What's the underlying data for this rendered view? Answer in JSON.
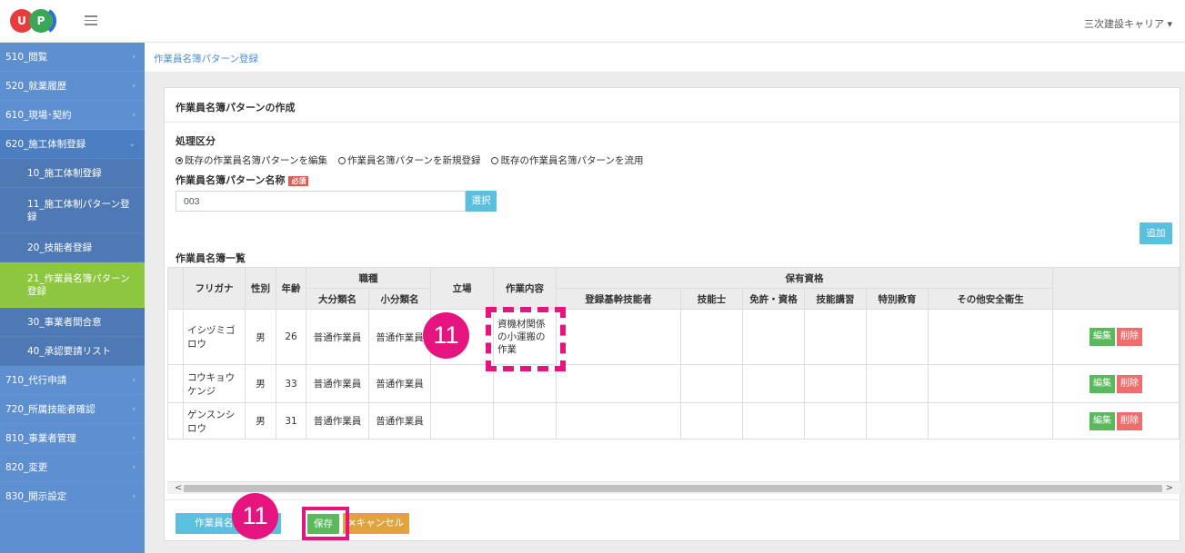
{
  "header": {
    "logo_text": "UP",
    "user_menu": "三次建設キャリア ▾"
  },
  "sidebar": {
    "items": [
      {
        "label": "510_閲覧"
      },
      {
        "label": "520_就業履歴"
      },
      {
        "label": "610_現場･契約"
      },
      {
        "label": "620_施工体制登録"
      },
      {
        "label": "710_代行申請"
      },
      {
        "label": "720_所属技能者確認"
      },
      {
        "label": "810_事業者管理"
      },
      {
        "label": "820_変更"
      },
      {
        "label": "830_開示設定"
      }
    ],
    "subitems": [
      {
        "label": "10_施工体制登録"
      },
      {
        "label": "11_施工体制パターン登録"
      },
      {
        "label": "20_技能者登録"
      },
      {
        "label": "21_作業員名簿パターン登録"
      },
      {
        "label": "30_事業者間合意"
      },
      {
        "label": "40_承認要請リスト"
      }
    ],
    "chevron": "‹"
  },
  "breadcrumb": "作業員名簿パターン登録",
  "panel": {
    "title": "作業員名簿パターンの作成",
    "process_label": "処理区分",
    "radios": [
      {
        "label": "既存の作業員名簿パターンを編集",
        "checked": true
      },
      {
        "label": "作業員名簿パターンを新規登録",
        "checked": false
      },
      {
        "label": "既存の作業員名簿パターンを流用",
        "checked": false
      }
    ],
    "name_label": "作業員名簿パターン名称",
    "required_badge": "必須",
    "name_value": "003",
    "select_button": "選択",
    "add_button": "追加",
    "list_title": "作業員名簿一覧"
  },
  "table": {
    "headers": {
      "furigana": "フリガナ",
      "gender": "性別",
      "age": "年齢",
      "job_type": "職種",
      "major": "大分類名",
      "minor": "小分類名",
      "position": "立場",
      "work": "作業内容",
      "qualifications": "保有資格",
      "registered_skill": "登録基幹技能者",
      "engineer": "技能士",
      "license": "免許・資格",
      "training": "技能講習",
      "special_edu": "特別教育",
      "other_safety": "その他安全衛生"
    },
    "rows": [
      {
        "furigana": "イシヅミゴロウ",
        "gender": "男",
        "age": "26",
        "major": "普通作業員",
        "minor": "普通作業員",
        "position": "",
        "work": "資機材関係の小運搬の作業"
      },
      {
        "furigana": "コウキョウケンジ",
        "gender": "男",
        "age": "33",
        "major": "普通作業員",
        "minor": "普通作業員",
        "position": "",
        "work": ""
      },
      {
        "furigana": "ゲンスンシロウ",
        "gender": "男",
        "age": "31",
        "major": "普通作業員",
        "minor": "普通作業員",
        "position": "",
        "work": ""
      }
    ],
    "edit_label": "編集",
    "delete_label": "削除"
  },
  "scrollbar": {
    "left": "<",
    "right": ">"
  },
  "footer": {
    "list_button": "作業員名簿一覧",
    "save_button": "保存",
    "cancel_button": "キャンセル",
    "cancel_icon": "×"
  },
  "annotations": {
    "marker_1": "11",
    "marker_2": "11"
  },
  "colors": {
    "sidebar": "#5d8fd1",
    "active_item": "#8dc63f",
    "info_button": "#5bc0de",
    "success_button": "#5cb85c",
    "danger_button": "#ee6e6e",
    "warning_button": "#e0a43e",
    "annotation": "#e5147e"
  }
}
